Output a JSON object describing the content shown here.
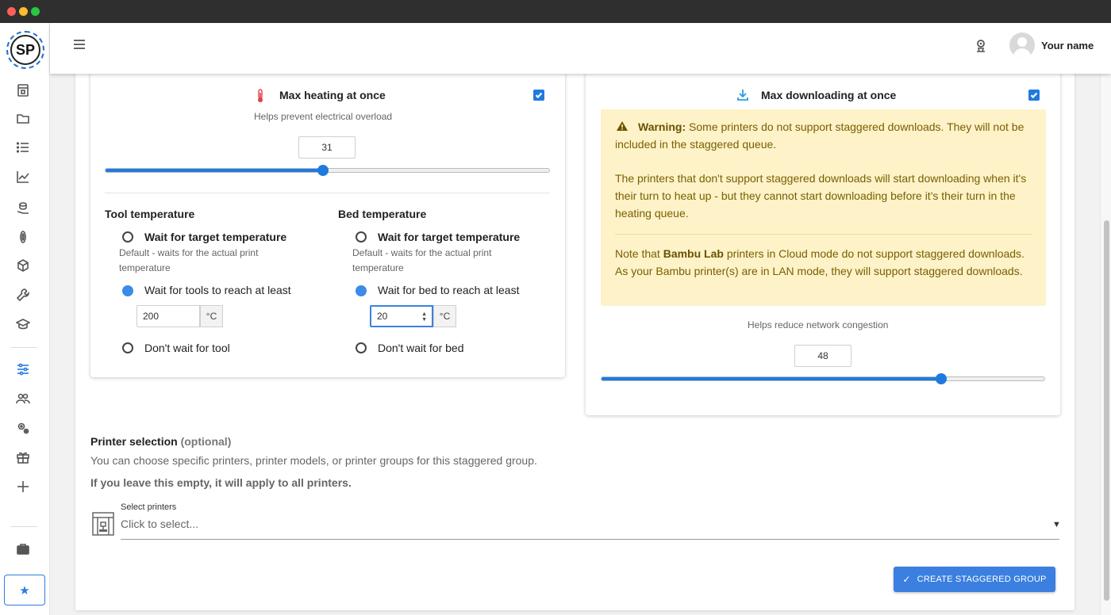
{
  "window": {
    "traffic_lights": [
      "close",
      "minimize",
      "zoom"
    ]
  },
  "app": {
    "logo_text": "SP"
  },
  "sidebar": {
    "items": [
      {
        "icon": "printer-farm-icon"
      },
      {
        "icon": "folder-icon"
      },
      {
        "icon": "list-icon"
      },
      {
        "icon": "chart-icon"
      },
      {
        "icon": "spool-hand-icon"
      },
      {
        "icon": "filament-icon"
      },
      {
        "icon": "cube-icon"
      },
      {
        "icon": "wrench-icon"
      },
      {
        "icon": "graduation-cap-icon"
      },
      {
        "icon": "sliders-icon",
        "active": true
      },
      {
        "icon": "users-icon"
      },
      {
        "icon": "gears-icon"
      },
      {
        "icon": "gift-icon"
      },
      {
        "icon": "plus-icon"
      },
      {
        "icon": "briefcase-icon"
      },
      {
        "icon": "star-icon"
      }
    ]
  },
  "topbar": {
    "username": "Your name"
  },
  "heating": {
    "title": "Max heating at once",
    "subtitle": "Helps prevent electrical overload",
    "checked": true,
    "value": "31",
    "slider_fraction": 0.49
  },
  "tool_temp": {
    "title": "Tool temperature",
    "option_target": "Wait for target temperature",
    "option_target_sub": "Default - waits for the actual print temperature",
    "option_reach": "Wait for tools to reach at least",
    "value": "200",
    "unit": "°C",
    "option_none": "Don't wait for tool",
    "selected": "reach"
  },
  "bed_temp": {
    "title": "Bed temperature",
    "option_target": "Wait for target temperature",
    "option_target_sub": "Default - waits for the actual print temperature",
    "option_reach": "Wait for bed to reach at least",
    "value": "20",
    "unit": "°C",
    "option_none": "Don't wait for bed",
    "selected": "reach"
  },
  "downloading": {
    "title": "Max downloading at once",
    "checked": true,
    "warning_label": "Warning:",
    "warning_text": " Some printers do not support staggered downloads. They will not be included in the staggered queue.",
    "warning_p2": "The printers that don't support staggered downloads will start downloading when it's their turn to heat up - but they cannot start downloading before it's their turn in the heating queue.",
    "note_prefix": "Note that ",
    "note_brand": "Bambu Lab",
    "note_suffix": " printers in Cloud mode do not support staggered downloads. As your Bambu printer(s) are in LAN mode, they will support staggered downloads.",
    "subtitle": "Helps reduce network congestion",
    "value": "48",
    "slider_fraction": 0.766
  },
  "printer_selection": {
    "title": "Printer selection",
    "optional": "(optional)",
    "description": "You can choose specific printers, printer models, or printer groups for this staggered group.",
    "note": "If you leave this empty, it will apply to all printers.",
    "select_label": "Select printers",
    "select_placeholder": "Click to select..."
  },
  "actions": {
    "create_label": "CREATE STAGGERED GROUP"
  },
  "colors": {
    "accent": "#1f7ae0",
    "warning_bg": "#fdf2c8",
    "warning_text": "#7a6000"
  }
}
